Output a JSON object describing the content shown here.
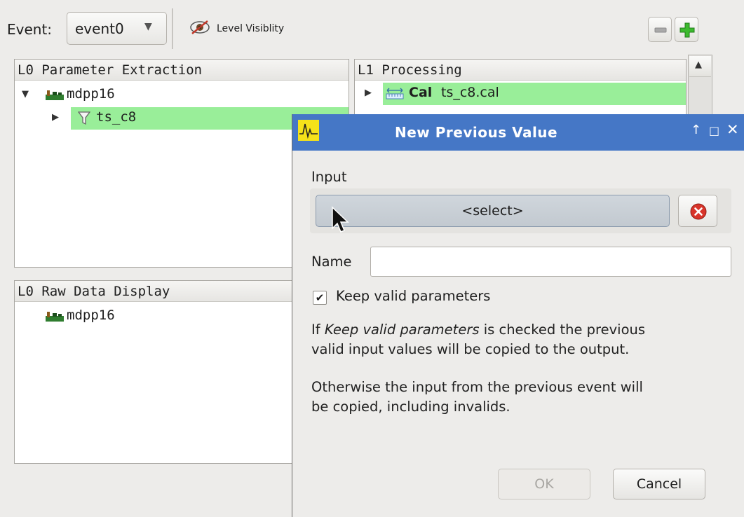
{
  "toolbar": {
    "event_label": "Event:",
    "event_value": "event0",
    "level_visibility_label": "Level Visiblity",
    "remove_icon": "minus-icon",
    "add_icon": "plus-icon"
  },
  "panels": {
    "l0_param": {
      "header": "L0 Parameter Extraction",
      "items": [
        {
          "label": "mdpp16",
          "icon": "module-icon",
          "expanded": true
        },
        {
          "label": "ts_c8",
          "icon": "filter-icon",
          "expanded": false,
          "selected": true
        }
      ]
    },
    "l1": {
      "header": "L1 Processing",
      "items": [
        {
          "tag": "Cal",
          "label": "ts_c8.cal",
          "icon": "calibration-icon",
          "selected": true
        }
      ]
    },
    "l0_raw": {
      "header": "L0 Raw Data Display",
      "items": [
        {
          "label": "mdpp16",
          "icon": "module-icon"
        }
      ]
    }
  },
  "dialog": {
    "title": "New  Previous Value",
    "input_label": "Input",
    "select_label": "<select>",
    "name_label": "Name",
    "name_value": "",
    "keep_checked": true,
    "keep_label": "Keep valid parameters",
    "desc1_prefix": "If ",
    "desc1_em": "Keep valid parameters",
    "desc1_rest": " is checked the previous",
    "desc1_line2": "valid input values will be copied to the output.",
    "desc2_line1": "Otherwise the input from the previous event will",
    "desc2_line2": "be copied, including invalids.",
    "ok_label": "OK",
    "cancel_label": "Cancel"
  },
  "colors": {
    "selection": "#99ee99",
    "titlebar": "#4577c6",
    "select_button": "#c8cfd6"
  }
}
